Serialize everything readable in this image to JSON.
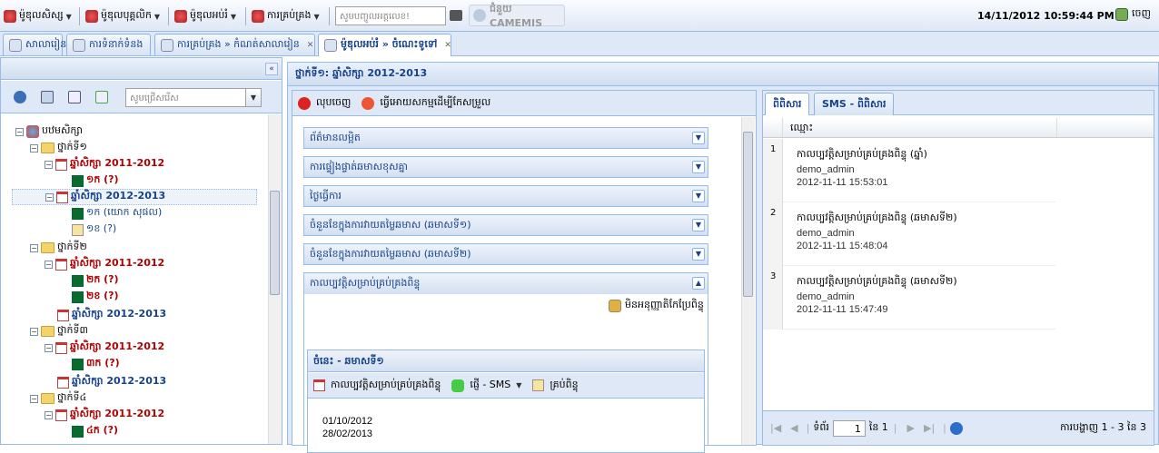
{
  "topbar": {
    "menus": [
      {
        "label": "ម៉ូឌុលសិស្ស"
      },
      {
        "label": "ម៉ូឌុលបុគ្គលិក"
      },
      {
        "label": "ម៉ូឌុលអប់រំ"
      },
      {
        "label": "ការគ្រប់គ្រង"
      }
    ],
    "search_placeholder": "សូមបញ្ចូលអត្តលេខ!",
    "help_label": "ជំនួយ CAMEMIS",
    "datetime": "14/11/2012 10:59:44 PM",
    "logout_label": "ចេញ"
  },
  "tabs": [
    {
      "label": "សាលារៀន"
    },
    {
      "label": "ការទំនាក់ទំនង"
    },
    {
      "label": "ការគ្រប់គ្រង » កំណត់សាលារៀន"
    },
    {
      "label": "ម៉ូឌុលអប់រំ » ចំណេះទូទៅ"
    }
  ],
  "left": {
    "combo_placeholder": "សូមជ្រើសរើស",
    "tree": [
      {
        "label": "បឋមសិក្សា",
        "style": "blk"
      },
      {
        "label": "ថ្នាក់ទី១",
        "style": "blk"
      },
      {
        "label": "ឆ្នាំសិក្សា 2011-2012",
        "style": "red"
      },
      {
        "label": "១ក (?)",
        "style": "red"
      },
      {
        "label": "ឆ្នាំសិក្សា 2012-2013",
        "style": "navy"
      },
      {
        "label": "១ក (យោក សុផល)",
        "style": "navy"
      },
      {
        "label": "១ខ (?)",
        "style": "navy"
      },
      {
        "label": "ថ្នាក់ទី២",
        "style": "blk"
      },
      {
        "label": "ឆ្នាំសិក្សា 2011-2012",
        "style": "red"
      },
      {
        "label": "២ក (?)",
        "style": "red"
      },
      {
        "label": "២ខ (?)",
        "style": "red"
      },
      {
        "label": "ឆ្នាំសិក្សា 2012-2013",
        "style": "navy"
      },
      {
        "label": "ថ្នាក់ទី៣",
        "style": "blk"
      },
      {
        "label": "ឆ្នាំសិក្សា 2011-2012",
        "style": "red"
      },
      {
        "label": "៣ក (?)",
        "style": "red"
      },
      {
        "label": "ឆ្នាំសិក្សា 2012-2013",
        "style": "navy"
      },
      {
        "label": "ថ្នាក់ទី៤",
        "style": "blk"
      },
      {
        "label": "ឆ្នាំសិក្សា 2011-2012",
        "style": "red"
      },
      {
        "label": "៤ក (?)",
        "style": "red"
      }
    ]
  },
  "center": {
    "title": "ថ្នាក់ទី១: ឆ្នាំសិក្សា 2012-2013",
    "remove_label": "លុបចេញ",
    "action_label": "ធ្វើអោយសកម្មដើម្បីកែសម្រួល",
    "sections": [
      {
        "label": "ព័ត៌មានលម្អិត"
      },
      {
        "label": "ការផ្ទៀងផ្ទាត់ឆមាសខុសគ្នា"
      },
      {
        "label": "ថ្ងៃធ្វើការ"
      },
      {
        "label": "ចំនួនខែក្នុងការវាយតម្លៃឆមាស (ឆមាសទី១)"
      },
      {
        "label": "ចំនួនខែក្នុងការវាយតម្លៃឆមាស (ឆមាសទី២)"
      },
      {
        "label": "កាលប្បវត្តិសម្រាប់គ្រប់គ្រងពិន្ទុ"
      }
    ],
    "lock_label": "មិនអនុញ្ញាតិកែប្រែពិន្ទុ",
    "inner_title": "ចំនេះ - ឆមាសទី១",
    "inner_btn1": "កាលប្បវត្តិសម្រាប់គ្រប់គ្រងពិន្ទុ",
    "inner_btn2": "ផ្ញើ - SMS",
    "inner_btn3": "គ្រប់ពិន្ទុ",
    "date_start": "01/10/2012",
    "date_end": "28/02/2013"
  },
  "right": {
    "tabs": [
      {
        "label": "ពិពិសារ"
      },
      {
        "label": "SMS - ពិពិសារ"
      }
    ],
    "column": "ឈ្មោះ",
    "rows": [
      {
        "num": "1",
        "title": "កាលប្បវត្តិសម្រាប់គ្រប់គ្រងពិន្ទុ (ឆ្នាំ)",
        "user": "demo_admin",
        "time": "2012-11-11 15:53:01"
      },
      {
        "num": "2",
        "title": "កាលប្បវត្តិសម្រាប់គ្រប់គ្រងពិន្ទុ (ឆមាសទី២)",
        "user": "demo_admin",
        "time": "2012-11-11 15:48:04"
      },
      {
        "num": "3",
        "title": "កាលប្បវត្តិសម្រាប់គ្រប់គ្រងពិន្ទុ (ឆមាសទី២)",
        "user": "demo_admin",
        "time": "2012-11-11 15:47:49"
      }
    ],
    "pager": {
      "page_label": "ទំព័រ",
      "page": "1",
      "of_label": "នៃ 1",
      "display": "ការបង្ហាញ 1 - 3 នៃ 3"
    }
  },
  "colors": {
    "accent": "#15428b",
    "panel_bg": "#dfe8f6",
    "border": "#99bbe8",
    "old_year": "#b20000"
  }
}
